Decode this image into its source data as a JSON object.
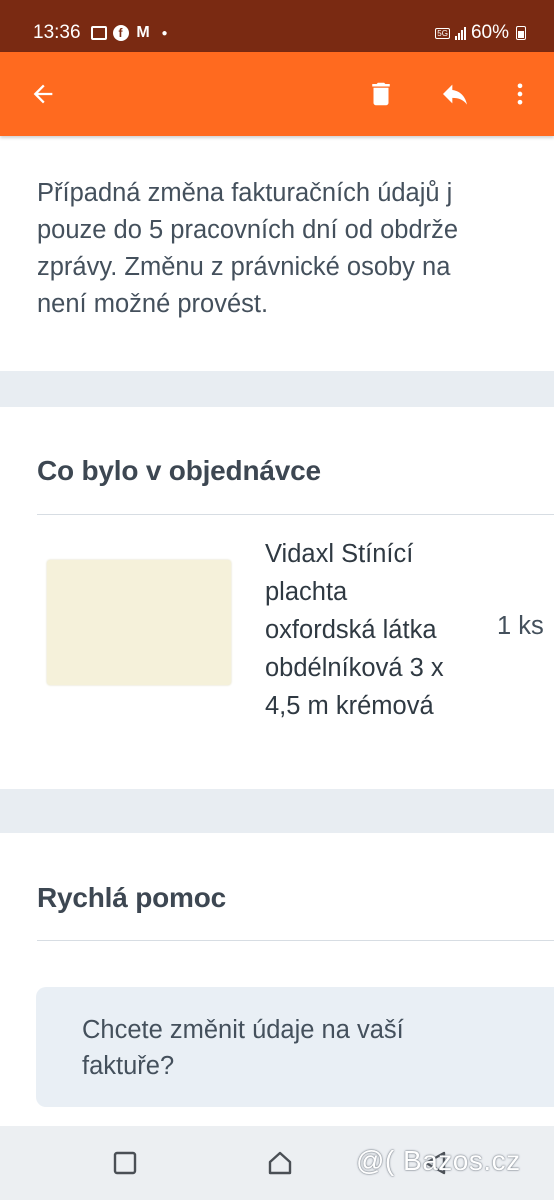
{
  "status_bar": {
    "time": "13:36",
    "network": "5G",
    "battery": "60%",
    "icons": [
      "gallery-icon",
      "facebook-icon",
      "gmail-icon",
      "dot-icon"
    ]
  },
  "toolbar": {
    "color": "#ff6a1f",
    "icons": [
      "back-arrow-icon",
      "trash-icon",
      "reply-icon",
      "more-vertical-icon"
    ]
  },
  "message": {
    "lines": [
      "Případná změna fakturačních údajů j",
      "pouze do 5 pracovních dní od obdrže",
      "zprávy. Změnu z právnické osoby na",
      "není možné provést."
    ]
  },
  "order": {
    "heading": "Co bylo v objednávce",
    "item": {
      "name_lines": [
        "Vidaxl Stínící",
        "plachta",
        "oxfordská látka",
        "obdélníková 3 x",
        "4,5 m krémová"
      ],
      "quantity": "1 ks"
    }
  },
  "help": {
    "heading": "Rychlá pomoc",
    "card_text": [
      "Chcete změnit údaje na vaší",
      "faktuře?"
    ]
  },
  "nav": {
    "icons": [
      "recent-apps-icon",
      "home-icon",
      "back-triangle-icon"
    ]
  },
  "watermark": "@( Bazos.cz"
}
